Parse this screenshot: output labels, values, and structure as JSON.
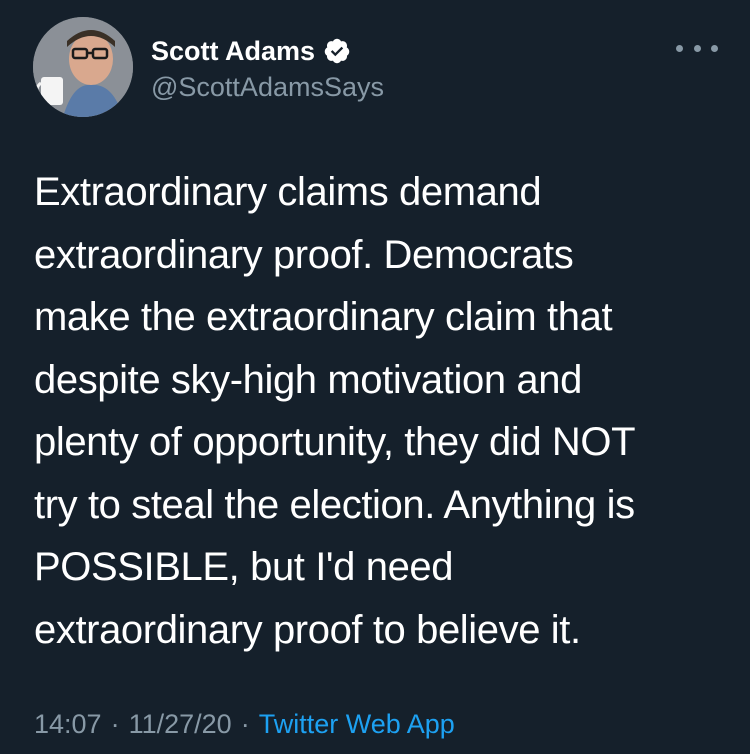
{
  "tweet": {
    "author": {
      "display_name": "Scott Adams",
      "handle": "@ScottAdamsSays",
      "verified": true,
      "avatar_icon": "profile-photo"
    },
    "more_icon": "more-dots-icon",
    "text": "Extraordinary claims demand\nextraordinary proof. Democrats\nmake the extraordinary claim that\ndespite sky-high motivation and\nplenty of opportunity, they did NOT\ntry to steal the election. Anything is\nPOSSIBLE, but I'd need\nextraordinary proof to believe it.",
    "meta": {
      "time": "14:07",
      "separator": "·",
      "date": "11/27/20",
      "source": "Twitter Web App"
    }
  },
  "colors": {
    "background": "#15202b",
    "primary_text": "#ffffff",
    "secondary_text": "#8899a6",
    "link": "#1da1f2",
    "verified_badge": "#ffffff"
  }
}
